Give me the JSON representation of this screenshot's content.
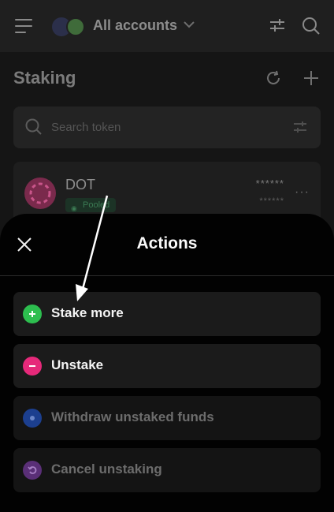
{
  "header": {
    "account_title": "All accounts"
  },
  "page": {
    "title": "Staking"
  },
  "search": {
    "placeholder": "Search token"
  },
  "token_row": {
    "name": "DOT",
    "tag": "Pooled",
    "balance_masked": "******",
    "value_masked": "******"
  },
  "actions_sheet": {
    "title": "Actions",
    "items": [
      {
        "label": "Stake more",
        "icon": "plus-circle-icon",
        "color": "#2dbe4f",
        "enabled": true
      },
      {
        "label": "Unstake",
        "icon": "minus-circle-icon",
        "color": "#e6297a",
        "enabled": true
      },
      {
        "label": "Withdraw unstaked funds",
        "icon": "withdraw-icon",
        "color": "#1c3f8f",
        "enabled": false
      },
      {
        "label": "Cancel unstaking",
        "icon": "undo-icon",
        "color": "#5a2f77",
        "enabled": false
      }
    ]
  },
  "colors": {
    "background": "#151515",
    "sheet": "#020202",
    "action_bg": "#1b1b1b"
  }
}
